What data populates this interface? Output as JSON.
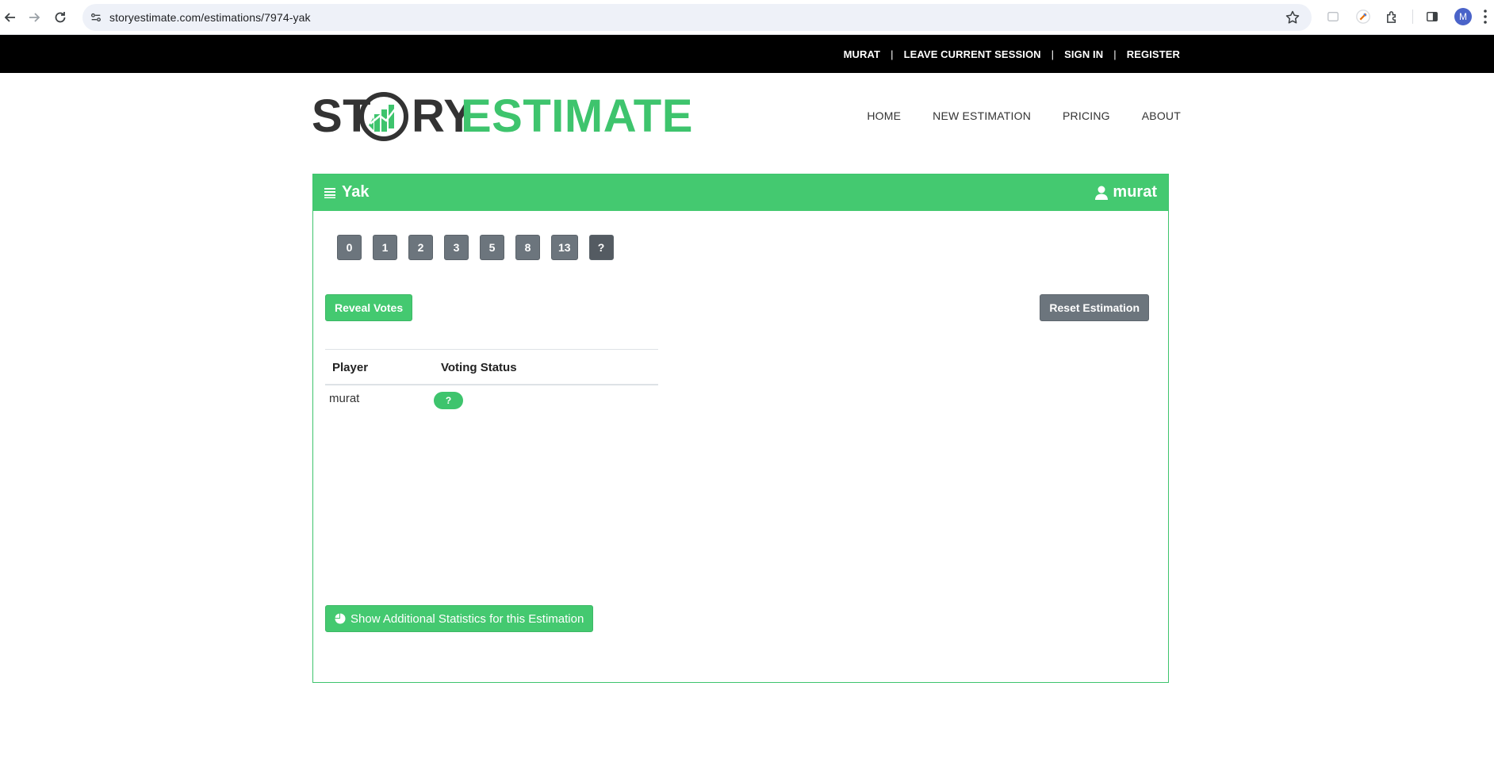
{
  "browser": {
    "url": "storyestimate.com/estimations/7974-yak",
    "profile_initial": "M"
  },
  "topbar": {
    "user": "MURAT",
    "leave": "LEAVE CURRENT SESSION",
    "signin": "SIGN IN",
    "register": "REGISTER",
    "separator": "|"
  },
  "logo": {
    "part1": "ST",
    "part2": "RY",
    "part3": "ESTIMATE"
  },
  "nav": {
    "items": [
      "HOME",
      "NEW ESTIMATION",
      "PRICING",
      "ABOUT"
    ]
  },
  "estimation": {
    "title": "Yak",
    "user": "murat",
    "cards": [
      "0",
      "1",
      "2",
      "3",
      "5",
      "8",
      "13",
      "?"
    ],
    "reveal_label": "Reveal Votes",
    "reset_label": "Reset Estimation",
    "table": {
      "headers": [
        "Player",
        "Voting Status"
      ],
      "rows": [
        {
          "player": "murat",
          "status": "?"
        }
      ]
    },
    "stats_label": "Show Additional Statistics for this Estimation"
  },
  "colors": {
    "brand_green": "#44c970",
    "button_gray": "#6c757d",
    "topbar_bg": "#000000"
  }
}
